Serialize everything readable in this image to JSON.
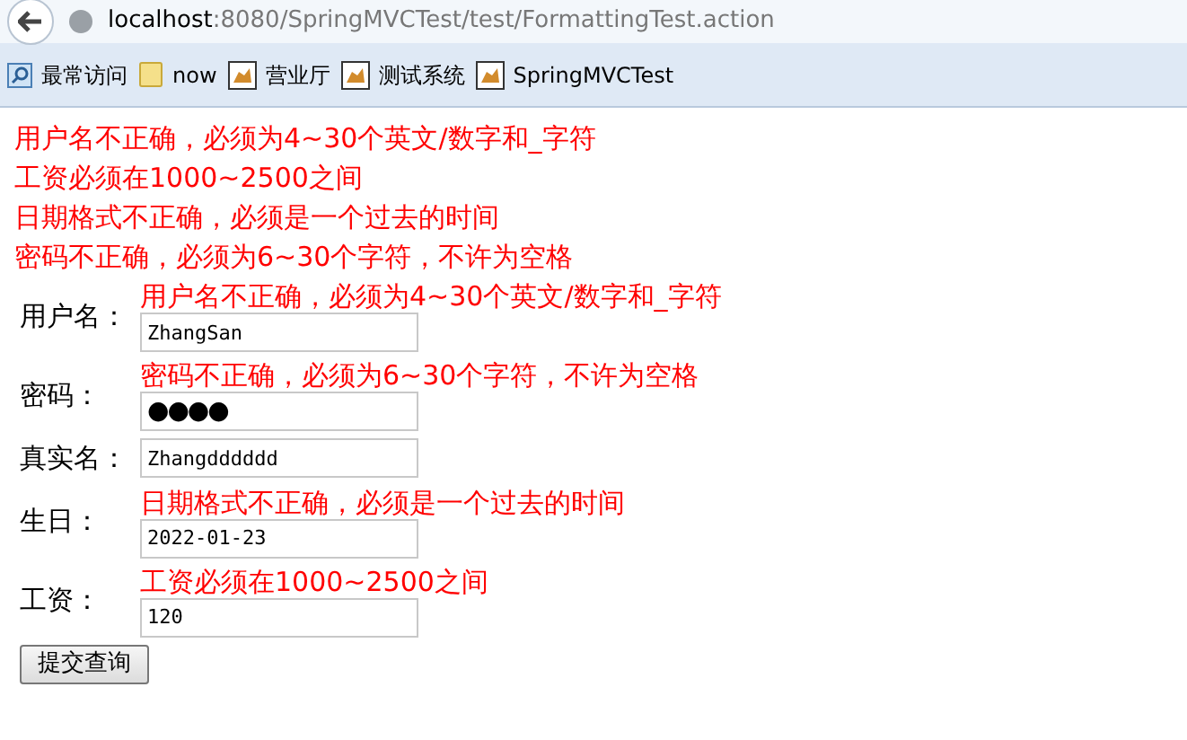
{
  "address_bar": {
    "host": "localhost",
    "path": ":8080/SpringMVCTest/test/FormattingTest.action"
  },
  "bookmarks": [
    {
      "label": "最常访问",
      "kind": "search"
    },
    {
      "label": "now",
      "kind": "folder"
    },
    {
      "label": "营业厅",
      "kind": "page"
    },
    {
      "label": "测试系统",
      "kind": "page"
    },
    {
      "label": "SpringMVCTest",
      "kind": "page"
    }
  ],
  "errors": [
    "用户名不正确，必须为4~30个英文/数字和_字符",
    "工资必须在1000~2500之间",
    "日期格式不正确，必须是一个过去的时间",
    "密码不正确，必须为6~30个字符，不许为空格"
  ],
  "form": [
    {
      "label": "用户名：",
      "error": "用户名不正确，必须为4~30个英文/数字和_字符",
      "value": "ZhangSan",
      "kind": "text"
    },
    {
      "label": "密码：",
      "error": "密码不正确，必须为6~30个字符，不许为空格",
      "value": "●●●●",
      "kind": "password"
    },
    {
      "label": "真实名：",
      "value": "Zhangdddddd",
      "kind": "text"
    },
    {
      "label": "生日：",
      "error": "日期格式不正确，必须是一个过去的时间",
      "value": "2022-01-23",
      "kind": "text"
    },
    {
      "label": "工资：",
      "error": "工资必须在1000~2500之间",
      "value": "120",
      "kind": "text"
    }
  ],
  "submit": "提交查询"
}
